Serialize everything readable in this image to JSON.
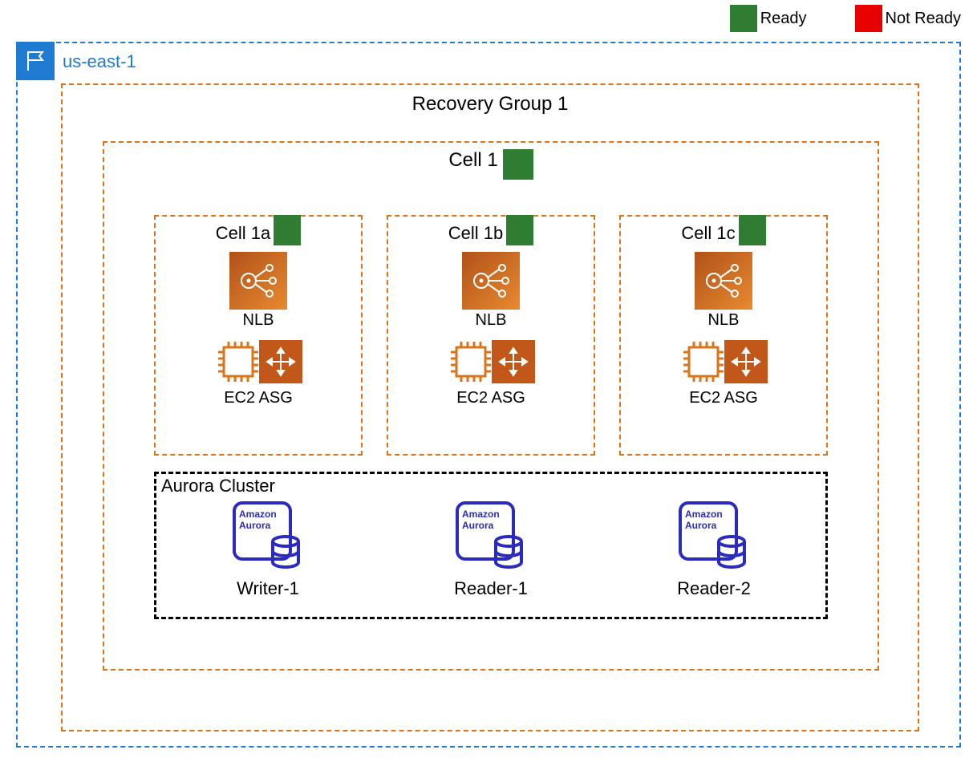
{
  "legend": {
    "ready": "Ready",
    "not_ready": "Not Ready"
  },
  "region": {
    "name": "us-east-1"
  },
  "recovery_group": {
    "title": "Recovery Group 1"
  },
  "cell1": {
    "title": "Cell 1",
    "status": "ready",
    "subcells": [
      {
        "title": "Cell 1a",
        "status": "ready",
        "nlb_label": "NLB",
        "asg_label": "EC2 ASG"
      },
      {
        "title": "Cell 1b",
        "status": "ready",
        "nlb_label": "NLB",
        "asg_label": "EC2 ASG"
      },
      {
        "title": "Cell 1c",
        "status": "ready",
        "nlb_label": "NLB",
        "asg_label": "EC2 ASG"
      }
    ]
  },
  "aurora": {
    "title": "Aurora Cluster",
    "icon_line1": "Amazon",
    "icon_line2": "Aurora",
    "nodes": [
      {
        "label": "Writer-1"
      },
      {
        "label": "Reader-1"
      },
      {
        "label": "Reader-2"
      }
    ]
  },
  "colors": {
    "ready": "#2e7d32",
    "not_ready": "#e60000",
    "region_border": "#1f7bd1",
    "orange_border": "#d97518",
    "aurora_blue": "#2b2bc0"
  }
}
